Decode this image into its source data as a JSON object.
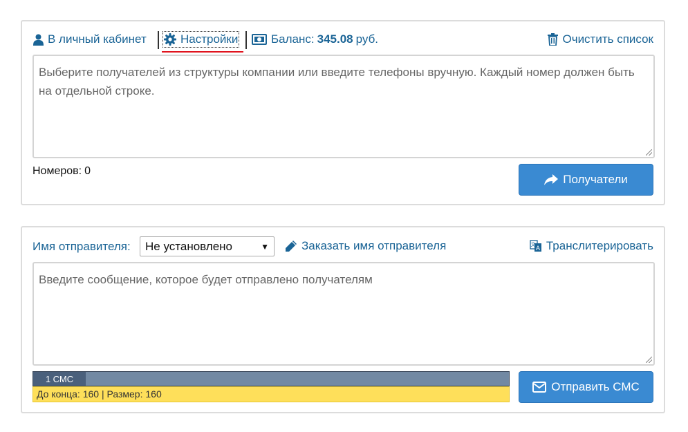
{
  "header": {
    "cabinet_label": "В личный кабинет",
    "settings_label": "Настройки",
    "balance_prefix": "Баланс:",
    "balance_value": "345.08",
    "balance_currency": "руб.",
    "clear_label": "Очистить список"
  },
  "recipients": {
    "placeholder": "Выберите получателей из структуры компании или введите телефоны вручную. Каждый номер должен быть на отдельной строке.",
    "count_label": "Номеров:",
    "count_value": "0",
    "button_label": "Получатели"
  },
  "message": {
    "sender_label": "Имя отправителя:",
    "sender_selected": "Не установлено",
    "order_name_label": "Заказать имя отправителя",
    "translit_label": "Транслитерировать",
    "placeholder": "Введите сообщение, которое будет отправлено получателям",
    "sms_count": "1 СМС",
    "sms_info": "До конца: 160 | Размер: 160",
    "send_label": "Отправить СМС"
  },
  "colors": {
    "link": "#1a6496",
    "button": "#3a8ad2",
    "sms_bar": "#7289a3",
    "sms_info_bg": "#fedf5a",
    "settings_underline": "#e0141e"
  },
  "icons": [
    "user-icon",
    "gear-icon",
    "money-icon",
    "trash-icon",
    "share-icon",
    "pencil-icon",
    "translate-icon",
    "envelope-icon"
  ]
}
